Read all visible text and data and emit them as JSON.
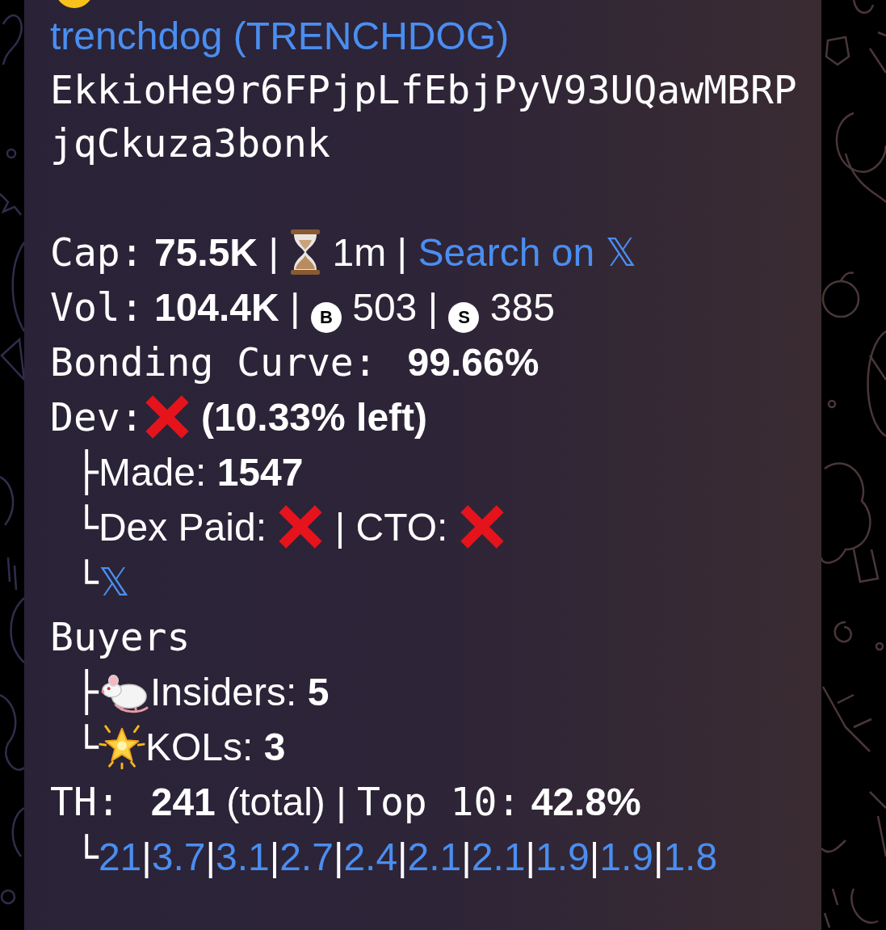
{
  "header": {
    "name": "trenchdog (TRENCHDOG)",
    "address_lines": [
      "EkkioHe9r6FPjpLfEbjPyV93UQawMBRP",
      "jqCkuza3bonk"
    ]
  },
  "cap": {
    "label": "Cap:",
    "value": "75.5K",
    "separator": "|",
    "age": "1m",
    "separator_2": "|",
    "link": "Search on 𝕏"
  },
  "volume": {
    "label": "Vol:",
    "value": "104.4K",
    "separator": "|",
    "buys_mark": "B",
    "buys": "503",
    "separator_2": "|",
    "sells_mark": "S",
    "sells": "385"
  },
  "bonding_curve": {
    "label": "Bonding Curve:",
    "value": "99.66%"
  },
  "dev": {
    "label": "Dev:",
    "check": false,
    "note": "(10.33% left)",
    "children": [
      {
        "kind": "made",
        "branch": "├",
        "label": "Made:",
        "value": "1547"
      },
      {
        "kind": "flags",
        "branch": "└",
        "label": "Dex Paid:",
        "dex_paid": false,
        "separator": "|",
        "label_2": "CTO:",
        "cto": false
      },
      {
        "kind": "link",
        "branch": "└",
        "link": "𝕏"
      }
    ]
  },
  "buyers": {
    "label": "Buyers",
    "children": [
      {
        "kind": "insiders",
        "branch": "├",
        "label": "Insiders:",
        "value": "5"
      },
      {
        "kind": "kols",
        "branch": "└",
        "label": "KOLs:",
        "value": "3"
      }
    ]
  },
  "holders": {
    "label": "TH:",
    "total": "241",
    "total_note": "(total)",
    "separator": "|",
    "top_label": "Top 10:",
    "top_value": "42.8%",
    "branch": "└",
    "top_shares": [
      {
        "value": "21"
      },
      {
        "separator": "|",
        "value": "3.7"
      },
      {
        "separator": "|",
        "value": "3.1"
      },
      {
        "separator": "|",
        "value": "2.7"
      },
      {
        "separator": "|",
        "value": "2.4"
      },
      {
        "separator": "|",
        "value": "2.1"
      },
      {
        "separator": "|",
        "value": "2.1"
      },
      {
        "separator": "|",
        "value": "1.9"
      },
      {
        "separator": "|",
        "value": "1.9"
      },
      {
        "separator": "|",
        "value": "1.8"
      }
    ]
  }
}
